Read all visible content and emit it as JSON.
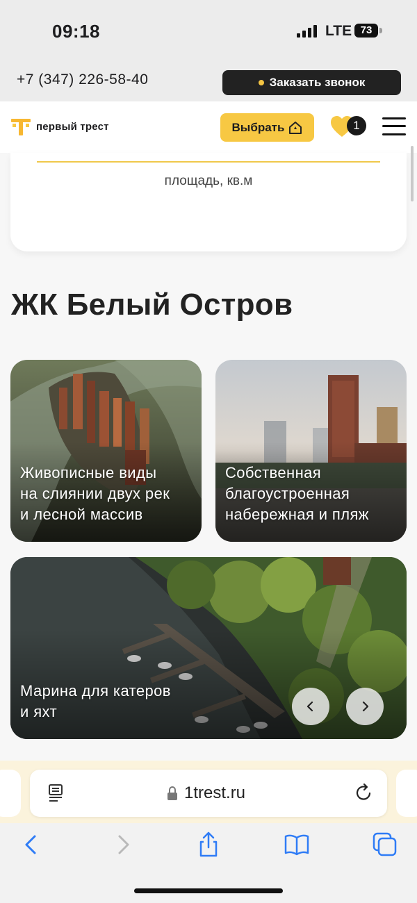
{
  "status_bar": {
    "time": "09:18",
    "network": "LTE",
    "battery": "73"
  },
  "contact_bar": {
    "phone": "+7 (347) 226-58-40",
    "call_button": "Заказать звонок"
  },
  "header": {
    "logo_text": "первый трест",
    "choose_button": "Выбрать",
    "favorites_count": "1"
  },
  "filter_card": {
    "label": "площадь, кв.м"
  },
  "section": {
    "title": "ЖК Белый Остров"
  },
  "tiles": [
    {
      "caption": "Живописные виды\nна слиянии двух рек\nи лесной массив"
    },
    {
      "caption": "Собственная\nблагоустроенная\nнабережная и пляж"
    },
    {
      "caption": "Марина для катеров\nи яхт"
    }
  ],
  "carousel": {
    "prev_icon": "chevron-left-icon",
    "next_icon": "chevron-right-icon"
  },
  "browser": {
    "url": "1trest.ru"
  },
  "colors": {
    "accent": "#f7c843",
    "dark": "#222222"
  }
}
